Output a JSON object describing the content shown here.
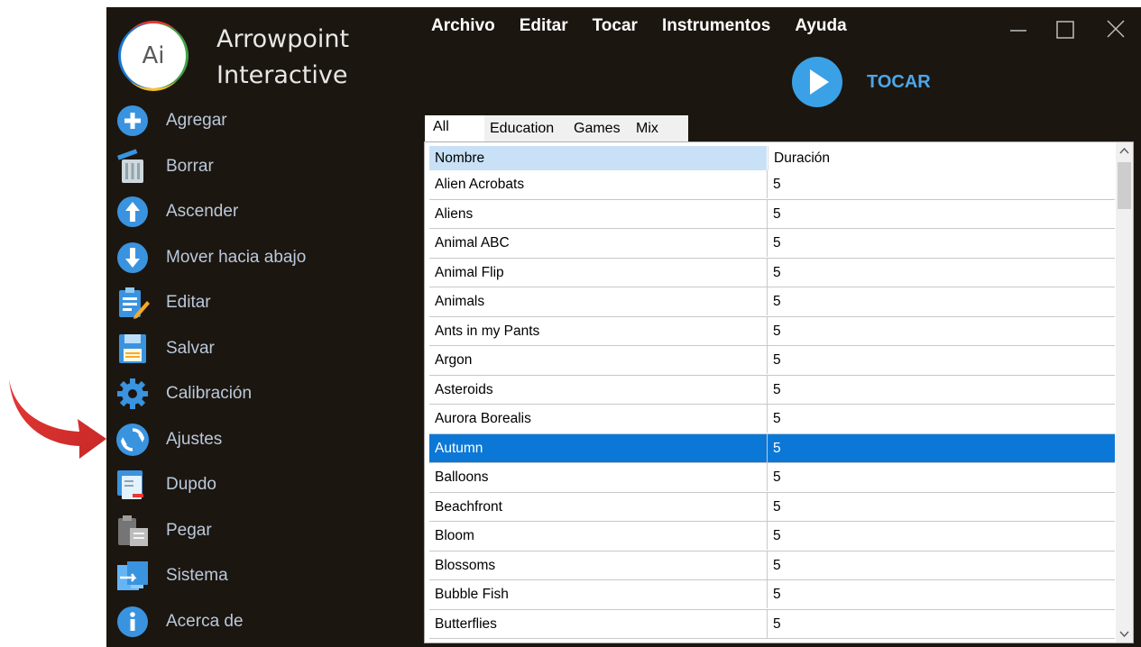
{
  "brand": {
    "logo_text": "Ai",
    "line1": "Arrowpoint",
    "line2": "Interactive"
  },
  "menubar": {
    "items": [
      "Archivo",
      "Editar",
      "Tocar",
      "Instrumentos",
      "Ayuda"
    ]
  },
  "sidebar": {
    "items": [
      {
        "label": "Agregar",
        "icon": "plus-circle-icon"
      },
      {
        "label": "Borrar",
        "icon": "trash-icon"
      },
      {
        "label": "Ascender",
        "icon": "arrow-up-circle-icon"
      },
      {
        "label": "Mover hacia abajo",
        "icon": "arrow-down-circle-icon"
      },
      {
        "label": "Editar",
        "icon": "clipboard-pencil-icon"
      },
      {
        "label": "Salvar",
        "icon": "save-disk-icon"
      },
      {
        "label": "Calibración",
        "icon": "gear-icon"
      },
      {
        "label": "Ajustes",
        "icon": "sync-icon"
      },
      {
        "label": "Dupdo",
        "icon": "duplicate-icon"
      },
      {
        "label": "Pegar",
        "icon": "paste-icon"
      },
      {
        "label": "Sistema",
        "icon": "system-icon"
      },
      {
        "label": "Acerca de",
        "icon": "info-icon"
      }
    ]
  },
  "play": {
    "label": "TOCAR"
  },
  "tabs": [
    "All",
    "Education",
    "Games",
    "Mix"
  ],
  "table": {
    "columns": [
      "Nombre",
      "Duración"
    ],
    "rows": [
      {
        "name": "Alien Acrobats",
        "duration": "5"
      },
      {
        "name": "Aliens",
        "duration": "5"
      },
      {
        "name": "Animal ABC",
        "duration": "5"
      },
      {
        "name": "Animal Flip",
        "duration": "5"
      },
      {
        "name": "Animals",
        "duration": "5"
      },
      {
        "name": "Ants in my Pants",
        "duration": "5"
      },
      {
        "name": "Argon",
        "duration": "5"
      },
      {
        "name": "Asteroids",
        "duration": "5"
      },
      {
        "name": "Aurora Borealis",
        "duration": "5"
      },
      {
        "name": "Autumn",
        "duration": "5",
        "selected": true
      },
      {
        "name": "Balloons",
        "duration": "5"
      },
      {
        "name": "Beachfront",
        "duration": "5"
      },
      {
        "name": "Bloom",
        "duration": "5"
      },
      {
        "name": "Blossoms",
        "duration": "5"
      },
      {
        "name": "Bubble Fish",
        "duration": "5"
      },
      {
        "name": "Butterflies",
        "duration": "5"
      }
    ]
  },
  "colors": {
    "window_bg": "#1c1610",
    "accent_blue": "#3aa1e6",
    "selection": "#0b78d7",
    "callout_arrow": "#e53935"
  }
}
